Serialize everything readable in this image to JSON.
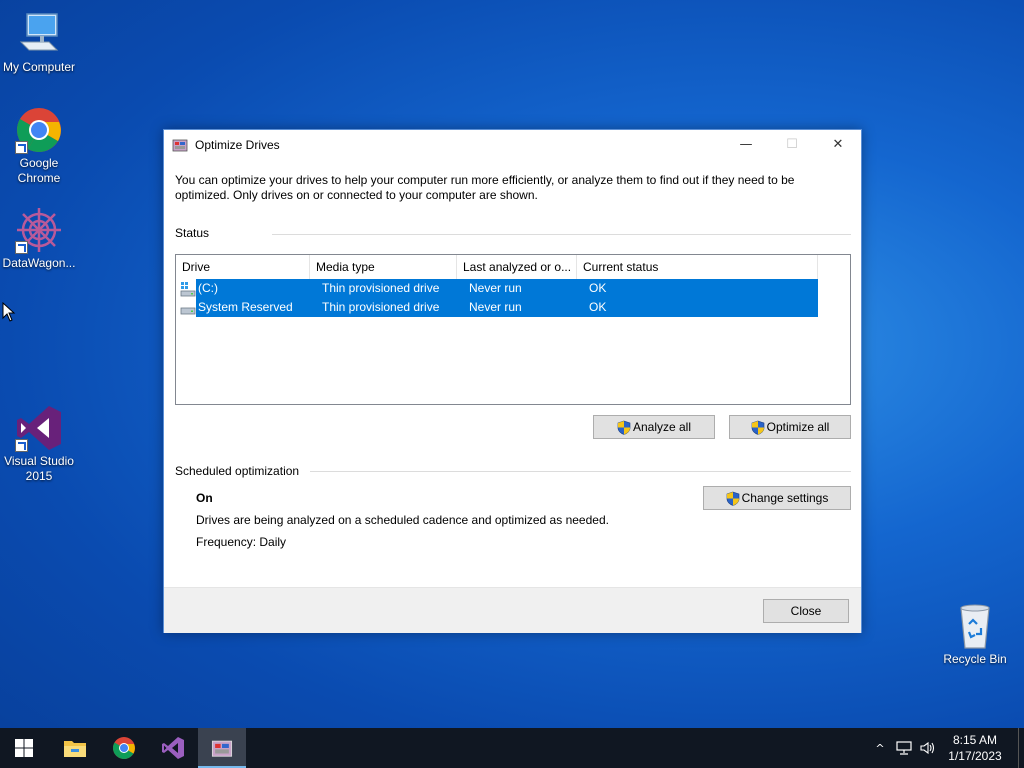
{
  "desktop": {
    "icons": [
      {
        "label": "My Computer"
      },
      {
        "label": "Google Chrome"
      },
      {
        "label": "DataWagon..."
      },
      {
        "label": "Visual Studio 2015"
      }
    ],
    "recycle_bin": "Recycle Bin"
  },
  "window": {
    "title": "Optimize Drives",
    "controls": {
      "minimize": "—",
      "maximize": "☐",
      "close": "✕"
    },
    "intro": "You can optimize your drives to help your computer run more efficiently, or analyze them to find out if they need to be optimized. Only drives on or connected to your computer are shown.",
    "status_label": "Status",
    "columns": [
      "Drive",
      "Media type",
      "Last analyzed or o...",
      "Current status"
    ],
    "drives": [
      {
        "drive": "(C:)",
        "media": "Thin provisioned drive",
        "last": "Never run",
        "status": "OK",
        "icon": "windows-drive-icon"
      },
      {
        "drive": "System Reserved",
        "media": "Thin provisioned drive",
        "last": "Never run",
        "status": "OK",
        "icon": "drive-icon"
      }
    ],
    "analyze_all": "Analyze all",
    "optimize_all": "Optimize all",
    "scheduled_label": "Scheduled optimization",
    "schedule_state": "On",
    "schedule_desc": "Drives are being analyzed on a scheduled cadence and optimized as needed.",
    "frequency": "Frequency: Daily",
    "change_settings": "Change settings",
    "close": "Close"
  },
  "taskbar": {
    "time": "8:15 AM",
    "date": "1/17/2023",
    "tray_chevron": "^"
  },
  "colors": {
    "selection": "#0078d7",
    "taskbar": "#101722",
    "desktop": "#1466cf"
  }
}
